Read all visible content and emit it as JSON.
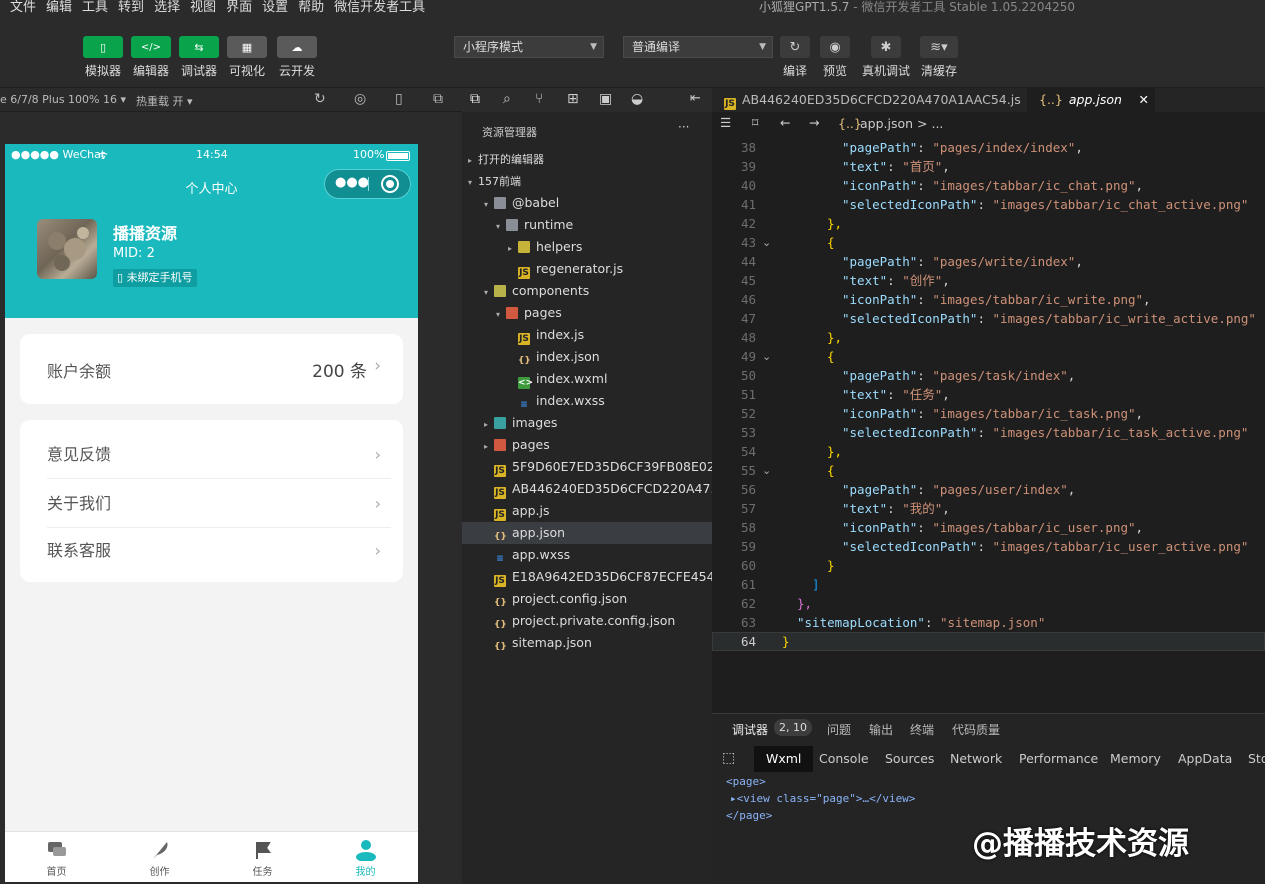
{
  "menubar": {
    "items": [
      "文件",
      "编辑",
      "工具",
      "转到",
      "选择",
      "视图",
      "界面",
      "设置",
      "帮助",
      "微信开发者工具"
    ],
    "title_app": "小狐狸GPT1.5.7",
    "title_rest": " - 微信开发者工具 Stable 1.05.2204250"
  },
  "toolbar": {
    "buttons": [
      "模拟器",
      "编辑器",
      "调试器",
      "可视化",
      "云开发"
    ],
    "mode_select": "小程序模式",
    "compile_select": "普通编译",
    "right_buttons": [
      "编译",
      "预览",
      "真机调试",
      "清缓存"
    ]
  },
  "simbar": {
    "device": "e 6/7/8 Plus 100% 16",
    "hotreload": "热重载 开"
  },
  "phone": {
    "status": {
      "carrier": "●●●●● WeChat",
      "time": "14:54",
      "battery": "100%"
    },
    "nav_title": "个人中心",
    "user": {
      "name": "播播资源",
      "mid": "MID: 2",
      "bind": "未绑定手机号"
    },
    "balance": {
      "label": "账户余额",
      "value": "200 条"
    },
    "menu": [
      "意见反馈",
      "关于我们",
      "联系客服"
    ],
    "tabs": [
      "首页",
      "创作",
      "任务",
      "我的"
    ]
  },
  "explorer": {
    "title": "资源管理器",
    "more": "···",
    "items": [
      {
        "label": "打开的编辑器",
        "depth": 0,
        "type": "section",
        "tw": "▸"
      },
      {
        "label": "157前端",
        "depth": 0,
        "type": "section",
        "tw": "▾"
      },
      {
        "label": "@babel",
        "depth": 1,
        "type": "folder",
        "tw": "▾"
      },
      {
        "label": "runtime",
        "depth": 2,
        "type": "folder",
        "tw": "▾"
      },
      {
        "label": "helpers",
        "depth": 3,
        "type": "folder-y",
        "tw": "▸"
      },
      {
        "label": "regenerator.js",
        "depth": 3,
        "type": "js",
        "tw": ""
      },
      {
        "label": "components",
        "depth": 1,
        "type": "folder-c",
        "tw": "▾"
      },
      {
        "label": "pages",
        "depth": 2,
        "type": "folder-r",
        "tw": "▾"
      },
      {
        "label": "index.js",
        "depth": 3,
        "type": "js",
        "tw": ""
      },
      {
        "label": "index.json",
        "depth": 3,
        "type": "json",
        "tw": ""
      },
      {
        "label": "index.wxml",
        "depth": 3,
        "type": "wxml",
        "tw": ""
      },
      {
        "label": "index.wxss",
        "depth": 3,
        "type": "wxss",
        "tw": ""
      },
      {
        "label": "images",
        "depth": 1,
        "type": "folder-t",
        "tw": "▸"
      },
      {
        "label": "pages",
        "depth": 1,
        "type": "folder-r",
        "tw": "▸"
      },
      {
        "label": "5F9D60E7ED35D6CF39FB08E02...",
        "depth": 1,
        "type": "js",
        "tw": ""
      },
      {
        "label": "AB446240ED35D6CFCD220A47...",
        "depth": 1,
        "type": "js",
        "tw": ""
      },
      {
        "label": "app.js",
        "depth": 1,
        "type": "js",
        "tw": ""
      },
      {
        "label": "app.json",
        "depth": 1,
        "type": "json",
        "tw": "",
        "selected": true
      },
      {
        "label": "app.wxss",
        "depth": 1,
        "type": "wxss",
        "tw": ""
      },
      {
        "label": "E18A9642ED35D6CF87ECFE454...",
        "depth": 1,
        "type": "js",
        "tw": ""
      },
      {
        "label": "project.config.json",
        "depth": 1,
        "type": "json",
        "tw": ""
      },
      {
        "label": "project.private.config.json",
        "depth": 1,
        "type": "json",
        "tw": ""
      },
      {
        "label": "sitemap.json",
        "depth": 1,
        "type": "json",
        "tw": ""
      }
    ]
  },
  "editor": {
    "tabs": [
      {
        "label": "AB446240ED35D6CFCD220A470A1AAC54.js",
        "icon": "JS"
      },
      {
        "label": "app.json",
        "icon": "{..}",
        "close": "✕"
      }
    ],
    "breadcrumb": "app.json > ...",
    "breadcrumb_icon": "{..}",
    "lines": [
      {
        "n": 38,
        "i": 8,
        "k": "\"pagePath\"",
        "v": "\"pages/index/index\"",
        "c": ","
      },
      {
        "n": 39,
        "i": 8,
        "k": "\"text\"",
        "v": "\"首页\"",
        "c": ","
      },
      {
        "n": 40,
        "i": 8,
        "k": "\"iconPath\"",
        "v": "\"images/tabbar/ic_chat.png\"",
        "c": ","
      },
      {
        "n": 41,
        "i": 8,
        "k": "\"selectedIconPath\"",
        "v": "\"images/tabbar/ic_chat_active.png\"",
        "c": ""
      },
      {
        "n": 42,
        "i": 6,
        "b": "},"
      },
      {
        "n": 43,
        "i": 6,
        "b": "{",
        "f": true
      },
      {
        "n": 44,
        "i": 8,
        "k": "\"pagePath\"",
        "v": "\"pages/write/index\"",
        "c": ","
      },
      {
        "n": 45,
        "i": 8,
        "k": "\"text\"",
        "v": "\"创作\"",
        "c": ","
      },
      {
        "n": 46,
        "i": 8,
        "k": "\"iconPath\"",
        "v": "\"images/tabbar/ic_write.png\"",
        "c": ","
      },
      {
        "n": 47,
        "i": 8,
        "k": "\"selectedIconPath\"",
        "v": "\"images/tabbar/ic_write_active.png\"",
        "c": ""
      },
      {
        "n": 48,
        "i": 6,
        "b": "},"
      },
      {
        "n": 49,
        "i": 6,
        "b": "{",
        "f": true
      },
      {
        "n": 50,
        "i": 8,
        "k": "\"pagePath\"",
        "v": "\"pages/task/index\"",
        "c": ","
      },
      {
        "n": 51,
        "i": 8,
        "k": "\"text\"",
        "v": "\"任务\"",
        "c": ","
      },
      {
        "n": 52,
        "i": 8,
        "k": "\"iconPath\"",
        "v": "\"images/tabbar/ic_task.png\"",
        "c": ","
      },
      {
        "n": 53,
        "i": 8,
        "k": "\"selectedIconPath\"",
        "v": "\"images/tabbar/ic_task_active.png\"",
        "c": ""
      },
      {
        "n": 54,
        "i": 6,
        "b": "},"
      },
      {
        "n": 55,
        "i": 6,
        "b": "{",
        "f": true
      },
      {
        "n": 56,
        "i": 8,
        "k": "\"pagePath\"",
        "v": "\"pages/user/index\"",
        "c": ","
      },
      {
        "n": 57,
        "i": 8,
        "k": "\"text\"",
        "v": "\"我的\"",
        "c": ","
      },
      {
        "n": 58,
        "i": 8,
        "k": "\"iconPath\"",
        "v": "\"images/tabbar/ic_user.png\"",
        "c": ","
      },
      {
        "n": 59,
        "i": 8,
        "k": "\"selectedIconPath\"",
        "v": "\"images/tabbar/ic_user_active.png\"",
        "c": ""
      },
      {
        "n": 60,
        "i": 6,
        "b": "}"
      },
      {
        "n": 61,
        "i": 4,
        "b": "]"
      },
      {
        "n": 62,
        "i": 2,
        "b": "},"
      },
      {
        "n": 63,
        "i": 2,
        "k": "\"sitemapLocation\"",
        "v": "\"sitemap.json\"",
        "c": ""
      },
      {
        "n": 64,
        "i": 0,
        "b": "}",
        "current": true
      }
    ]
  },
  "devtools": {
    "tabs": [
      "调试器",
      "问题",
      "输出",
      "终端",
      "代码质量"
    ],
    "badge": "2, 10",
    "subtabs": [
      "Wxml",
      "Console",
      "Sources",
      "Network",
      "Performance",
      "Memory",
      "AppData",
      "Sto"
    ],
    "xml": [
      "<page>",
      "▸<view class=\"page\">…</view>",
      "</page>"
    ]
  },
  "watermark": "@播播技术资源"
}
